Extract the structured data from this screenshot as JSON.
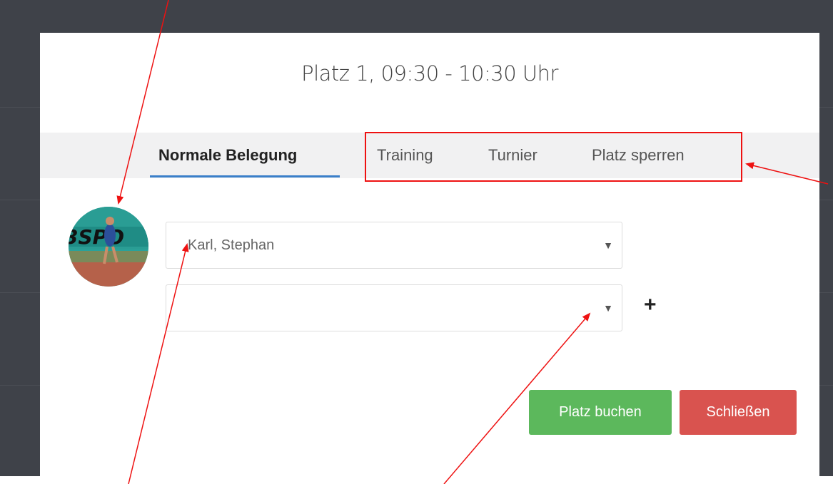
{
  "modal": {
    "title": "Platz 1, 09:30 - 10:30 Uhr",
    "tabs": [
      {
        "label": "Normale Belegung",
        "active": true
      },
      {
        "label": "Training",
        "active": false
      },
      {
        "label": "Turnier",
        "active": false
      },
      {
        "label": "Platz sperren",
        "active": false
      }
    ],
    "player1": {
      "value": "Karl, Stephan"
    },
    "player2": {
      "value": ""
    },
    "add_player_label": "+",
    "book_button": "Platz buchen",
    "close_button": "Schließen"
  },
  "colors": {
    "backdrop": "#3f4249",
    "tab_active_underline": "#3a7fc9",
    "book_button": "#5cb85c",
    "close_button": "#d9534f",
    "annotation": "#ee1111"
  }
}
